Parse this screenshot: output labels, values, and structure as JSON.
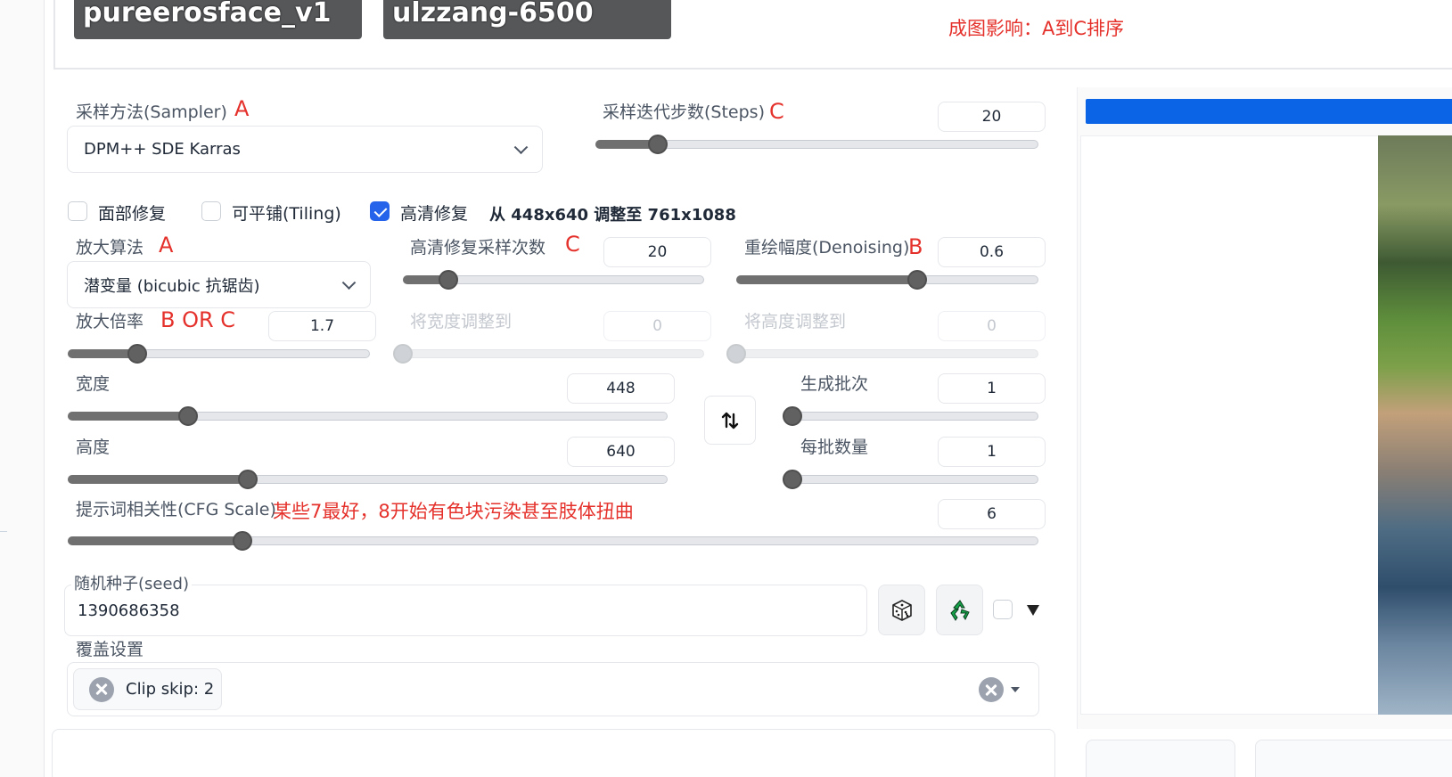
{
  "models": {
    "model1": "pureerosface_v1",
    "model2": "ulzzang-6500",
    "note": "成图影响：A到C排序"
  },
  "sampler": {
    "label": "采样方法(Sampler)",
    "annotation": "A",
    "value": "DPM++ SDE Karras"
  },
  "steps": {
    "label": "采样迭代步数(Steps)",
    "annotation": "C",
    "value": "20",
    "fraction": 0.14
  },
  "checks": {
    "face_restore": {
      "label": "面部修复",
      "checked": false
    },
    "tiling": {
      "label": "可平铺(Tiling)",
      "checked": false
    },
    "hires": {
      "label": "高清修复",
      "checked": true
    },
    "hires_info": "从 448x640 调整至 761x1088"
  },
  "hires": {
    "upscaler_label": "放大算法",
    "upscaler_annotation": "A",
    "upscaler_value": "潜变量 (bicubic 抗锯齿)",
    "steps_label": "高清修复采样次数",
    "steps_annotation": "C",
    "steps_value": "20",
    "steps_fraction": 0.15,
    "denoise_label": "重绘幅度(Denoising)",
    "denoise_annotation": "B",
    "denoise_value": "0.6",
    "denoise_fraction": 0.6,
    "scale_label": "放大倍率",
    "scale_annotation": "B OR C",
    "scale_value": "1.7",
    "scale_fraction": 0.23,
    "resize_w_label": "将宽度调整到",
    "resize_w_value": "0",
    "resize_h_label": "将高度调整到",
    "resize_h_value": "0"
  },
  "dims": {
    "width_label": "宽度",
    "width_value": "448",
    "width_fraction": 0.2,
    "height_label": "高度",
    "height_value": "640",
    "height_fraction": 0.3,
    "swap_icon": "swap-vertical-icon"
  },
  "batch": {
    "count_label": "生成批次",
    "count_value": "1",
    "count_fraction": 0,
    "size_label": "每批数量",
    "size_value": "1",
    "size_fraction": 0
  },
  "cfg": {
    "label": "提示词相关性(CFG Scale)",
    "annotation": "某些7最好，8开始有色块污染甚至肢体扭曲",
    "value": "6",
    "fraction": 0.18
  },
  "seed": {
    "label": "随机种子(seed)",
    "value": "1390686358",
    "dice_icon": "dice-icon",
    "recycle_icon": "recycle-icon",
    "expand_icon": "triangle-down-icon"
  },
  "override": {
    "label": "覆盖设置",
    "tag": "Clip skip: 2"
  },
  "colors": {
    "accent": "#2563eb",
    "annotation": "#e5312b",
    "progress": "#0b63e5"
  }
}
